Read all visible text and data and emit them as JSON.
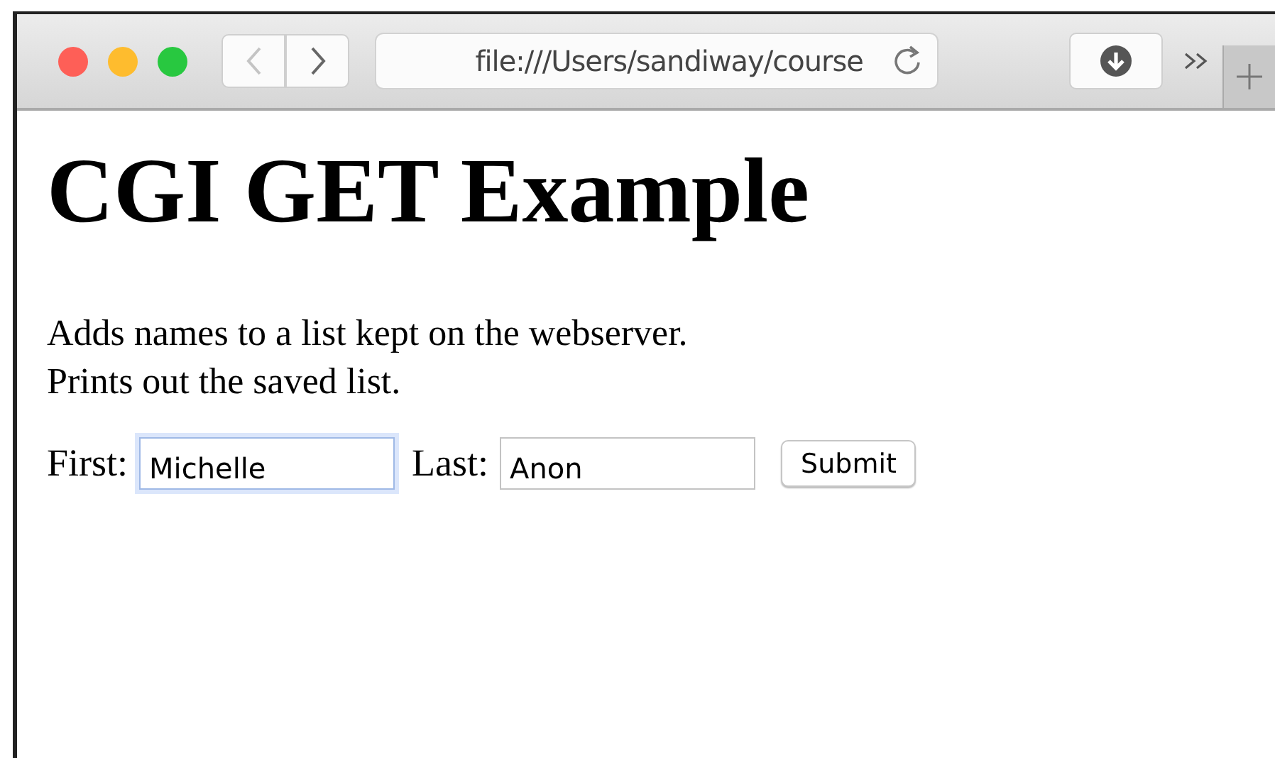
{
  "toolbar": {
    "address": "file:///Users/sandiway/course"
  },
  "page": {
    "heading": "CGI GET Example",
    "lines": [
      "Adds names to a list kept on the webserver.",
      "Prints out the saved list."
    ],
    "form": {
      "fields": [
        {
          "label": "First:",
          "value": "Michelle",
          "focused": true
        },
        {
          "label": "Last:",
          "value": "Anon",
          "focused": false
        }
      ],
      "submit": "Submit"
    }
  }
}
